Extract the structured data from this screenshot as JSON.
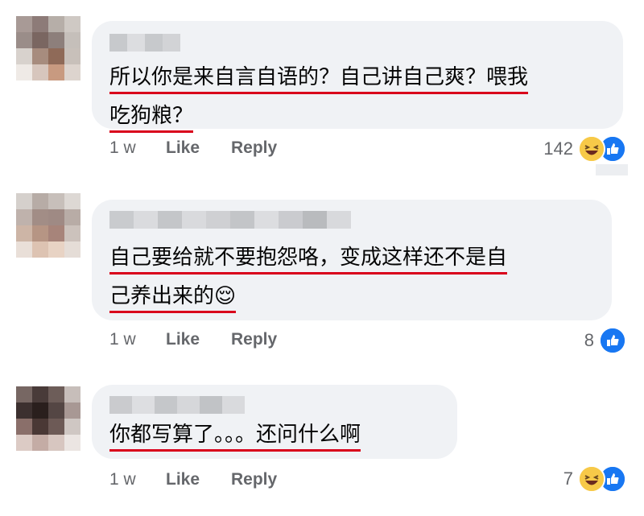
{
  "comments": [
    {
      "lines": [
        "所以你是来自言自语的？自己讲自己爽？喂我",
        "吃狗粮？"
      ],
      "time": "1 w",
      "like": "Like",
      "reply": "Reply",
      "reaction_count": "142",
      "reactions": [
        "haha-icon",
        "like-icon"
      ]
    },
    {
      "lines": [
        "自己要给就不要抱怨咯，变成这样还不是自",
        "己养出来的😌"
      ],
      "time": "1 w",
      "like": "Like",
      "reply": "Reply",
      "reaction_count": "8",
      "reactions": [
        "like-icon"
      ]
    },
    {
      "lines": [
        "你都写算了。。。还问什么啊"
      ],
      "time": "1 w",
      "like": "Like",
      "reply": "Reply",
      "reaction_count": "7",
      "reactions": [
        "haha-icon",
        "like-icon"
      ]
    }
  ],
  "colors": {
    "bubble": "#f0f2f5",
    "underline": "#d9001b",
    "meta": "#65676b",
    "like_blue": "#1877f2",
    "haha_yellow": "#f7c948"
  }
}
